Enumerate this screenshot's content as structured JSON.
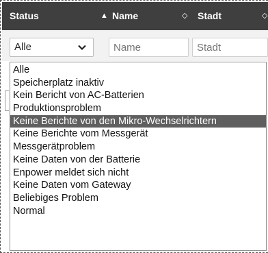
{
  "table": {
    "columns": [
      {
        "label": "Status",
        "sort": "ascending"
      },
      {
        "label": "Name",
        "sort": "none"
      },
      {
        "label": "Stadt",
        "sort": "none"
      }
    ]
  },
  "filters": {
    "status_value": "Alle",
    "name_placeholder": "Name",
    "stadt_placeholder": "Stadt"
  },
  "status_options": [
    "Alle",
    "Speicherplatz inaktiv",
    "Kein Bericht von AC-Batterien",
    "Produktionsproblem",
    "Keine Berichte von den Mikro-Wechselrichtern",
    "Keine Berichte vom Messgerät",
    "Messgerätproblem",
    "Keine Daten von der Batterie",
    "Enpower meldet sich nicht",
    "Keine Daten vom Gateway",
    "Beliebiges Problem",
    "Normal"
  ],
  "highlighted_option": "Keine Berichte von den Mikro-Wechselrichtern",
  "colors": {
    "header_bg": "#3f3f3f",
    "highlight_bg": "#5f5f5f",
    "header_text": "#ffffff"
  }
}
